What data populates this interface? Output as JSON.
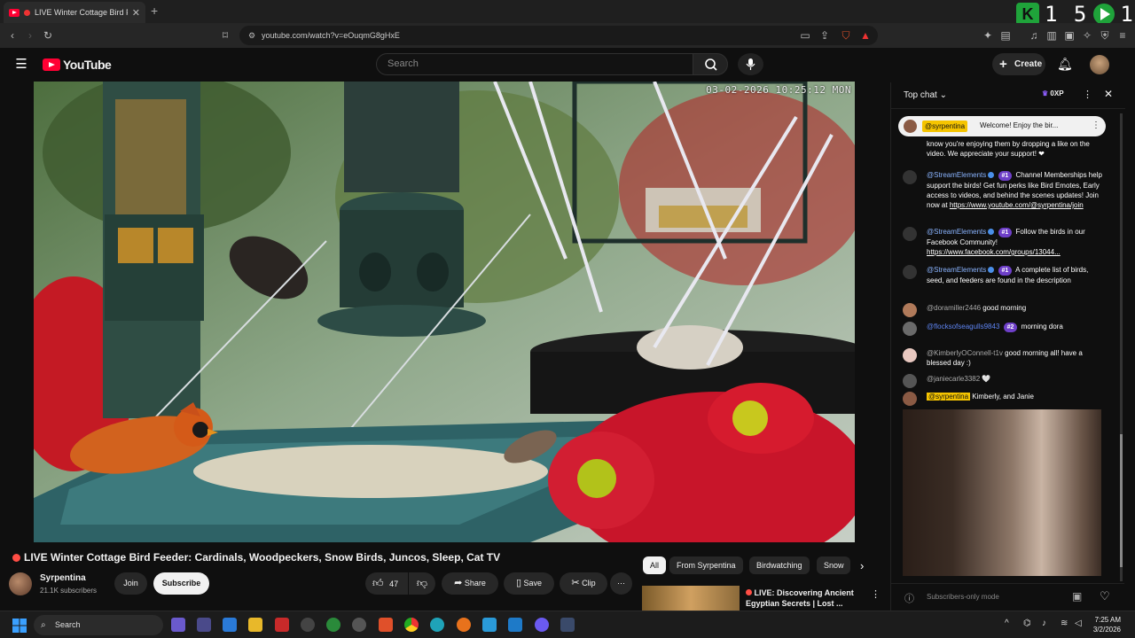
{
  "browser": {
    "tab_title": "LIVE Winter Cottage Bird F",
    "url": "youtube.com/watch?v=eOuqmG8gHxE",
    "overlay_counter": "1 5",
    "overlay_counter2": "1"
  },
  "header": {
    "logo_text": "YouTube",
    "search_placeholder": "Search",
    "create_label": "Create"
  },
  "video": {
    "timestamp": "03-02-2026 10:25:12 MON",
    "title": "LIVE Winter Cottage Bird Feeder: Cardinals, Woodpeckers, Snow Birds, Juncos, Sleep, Cat TV",
    "channel": "Syrpentina",
    "subscribers": "21.1K subscribers",
    "join_label": "Join",
    "subscribe_label": "Subscribe",
    "likes": "47",
    "share_label": "Share",
    "save_label": "Save",
    "clip_label": "Clip"
  },
  "chips": [
    "All",
    "From Syrpentina",
    "Birdwatching",
    "Snow"
  ],
  "recommended": {
    "title_line1": "LIVE: Discovering Ancient",
    "title_line2": "Egyptian Secrets | Lost ..."
  },
  "chat": {
    "mode_label": "Top chat",
    "points_label": "0XP",
    "pinned_author": "@syrpentina",
    "pinned_text": "Welcome! Enjoy the bir...",
    "footer_text": "Subscribers-only mode",
    "messages": [
      {
        "text": "know you're enjoying them by dropping a like on the video. We appreciate your support! ❤"
      },
      {
        "author": "@StreamElements",
        "badge": "#1",
        "text": "Channel Memberships help support the birds! Get fun perks like Bird Emotes, Early access to videos, and behind the scenes updates! Join now at",
        "link": "https://www.youtube.com/@syrpentina/join"
      },
      {
        "author": "@StreamElements",
        "badge": "#1",
        "text": "Follow the birds in our Facebook Community!",
        "link": "https://www.facebook.com/groups/13044..."
      },
      {
        "author": "@StreamElements",
        "badge": "#1",
        "text": "A complete list of birds, seed, and feeders are found in the description"
      },
      {
        "author": "@doramiller2446",
        "text": "good morning"
      },
      {
        "author": "@flocksofseagulls9843",
        "badge": "#2",
        "text": "morning dora"
      },
      {
        "author": "@KimberlyOConnell-t1v",
        "text": "good morning all! have a blessed day :)"
      },
      {
        "author": "@janiecarle3382",
        "text": "🤍"
      },
      {
        "author": "@syrpentina",
        "text": "Kimberly, and Janie"
      }
    ]
  },
  "taskbar": {
    "search_label": "Search",
    "time": "7:25 AM",
    "date": "3/2/2026"
  },
  "colors": {
    "youtube_red": "#ff0033",
    "background": "#0f0f0f",
    "member_badge": "#6e3fc8",
    "overlay_green": "#1fa33a"
  }
}
